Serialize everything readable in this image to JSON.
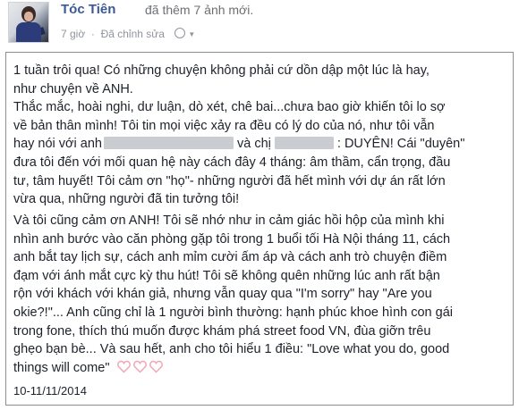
{
  "post": {
    "author": "Tóc Tiên",
    "action": "đã thêm 7 ảnh mới.",
    "time": "7 giờ",
    "edited": "Đã chỉnh sửa",
    "privacy_icon": "globe-icon"
  },
  "body": {
    "p1": [
      "1 tuần trôi qua! Có những chuyện không phải cứ dồn dập một lúc là hay,",
      "như chuyện về ANH.",
      "Thắc mắc, hoài nghi, dư luận, dò xét, chê bai...chưa bao giờ khiến tôi lo sợ",
      "về bản thân mình! Tôi tin mọi việc xảy ra đều có lý do của nó, như tôi vẫn"
    ],
    "p1_line5_a": "hay nói với anh",
    "p1_line5_b": "và chị",
    "p1_line5_c": ": DUYÊN! Cái \"duyên\"",
    "p1_rest": [
      "đưa tôi đến với mối quan hệ này cách đây 4 tháng: âm thầm, cẩn trọng, đầu",
      "tư, tâm huyết! Tôi cảm ơn \"họ\"- những người đã hết mình với dự án rất lớn",
      "vừa qua, những người đã tin tưởng tôi!"
    ],
    "p2": [
      "Và tôi cũng cảm ơn ANH! Tôi sẽ nhớ như in cảm giác hồi hộp của mình khi",
      "nhìn anh bước vào căn phòng gặp tôi trong 1 buổi tối Hà Nội tháng 11, cách",
      "anh bắt tay lịch sự, cách anh mỉm cười ấm áp và cách anh trò chuyện điềm",
      "đạm với ánh mắt cực kỳ thu hút! Tôi sẽ không quên những lúc anh rất bận",
      "rộn với khách với khán giả, nhưng vẫn quay qua \"I'm sorry\" hay \"Are you",
      "okie?!\"... Anh cũng chỉ là 1 người bình thường: hạnh phúc khoe hình con gái",
      "trong fone, thích thú muốn được khám phá street food VN, đùa giỡn trêu",
      "ghẹo bạn bè... Và sau hết, anh cho tôi hiểu 1 điều: \"Love what you do, good"
    ],
    "p2_last": "things will come\"",
    "date": "10-11/11/2014",
    "heart_color": "#f2a7b5"
  }
}
